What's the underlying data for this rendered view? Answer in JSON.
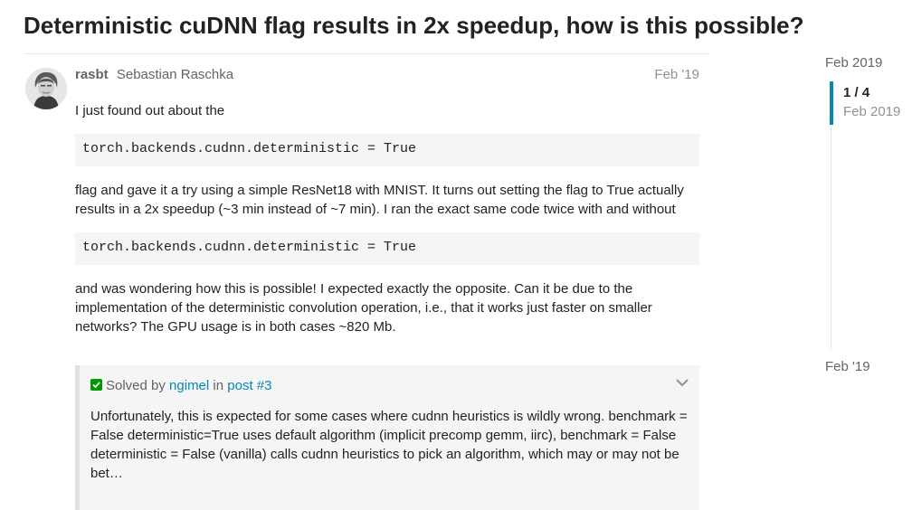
{
  "topic": {
    "title": "Deterministic cuDNN flag results in 2x speedup, how is this possible?"
  },
  "post": {
    "username": "rasbt",
    "fullname": "Sebastian Raschka",
    "date": "Feb '19",
    "paragraph1": "I just found out about the",
    "code1": "torch.backends.cudnn.deterministic = True",
    "paragraph2": "flag and gave it a try using a simple ResNet18 with MNIST. It turns out setting the flag to True actually results in a 2x speedup (~3 min instead of ~7 min). I ran the exact same code twice with and without",
    "code2": "torch.backends.cudnn.deterministic = True",
    "paragraph3": "and was wondering how this is possible! I expected exactly the opposite. Can it be due to the implementation of the deterministic convolution operation, i.e., that it works just faster on smaller networks? The GPU usage is in both cases ~820 Mb."
  },
  "solution": {
    "solved_by_label": "Solved by",
    "solver": "ngimel",
    "in_label": "in",
    "post_link": "post #3",
    "excerpt": "Unfortunately, this is expected for some cases where cudnn heuristics is wildly wrong. benchmark = False deterministic=True uses default algorithm (implicit precomp gemm, iirc), benchmark = False deterministic = False (vanilla) calls cudnn heuristics to pick an algorithm, which may or may not be bet…"
  },
  "timeline": {
    "start_date": "Feb 2019",
    "position": "1 / 4",
    "position_date": "Feb 2019",
    "end_date": "Feb '19"
  },
  "colors": {
    "link": "#0a86b3",
    "solved_check": "#009900",
    "code_bg": "#f5f5f5"
  }
}
